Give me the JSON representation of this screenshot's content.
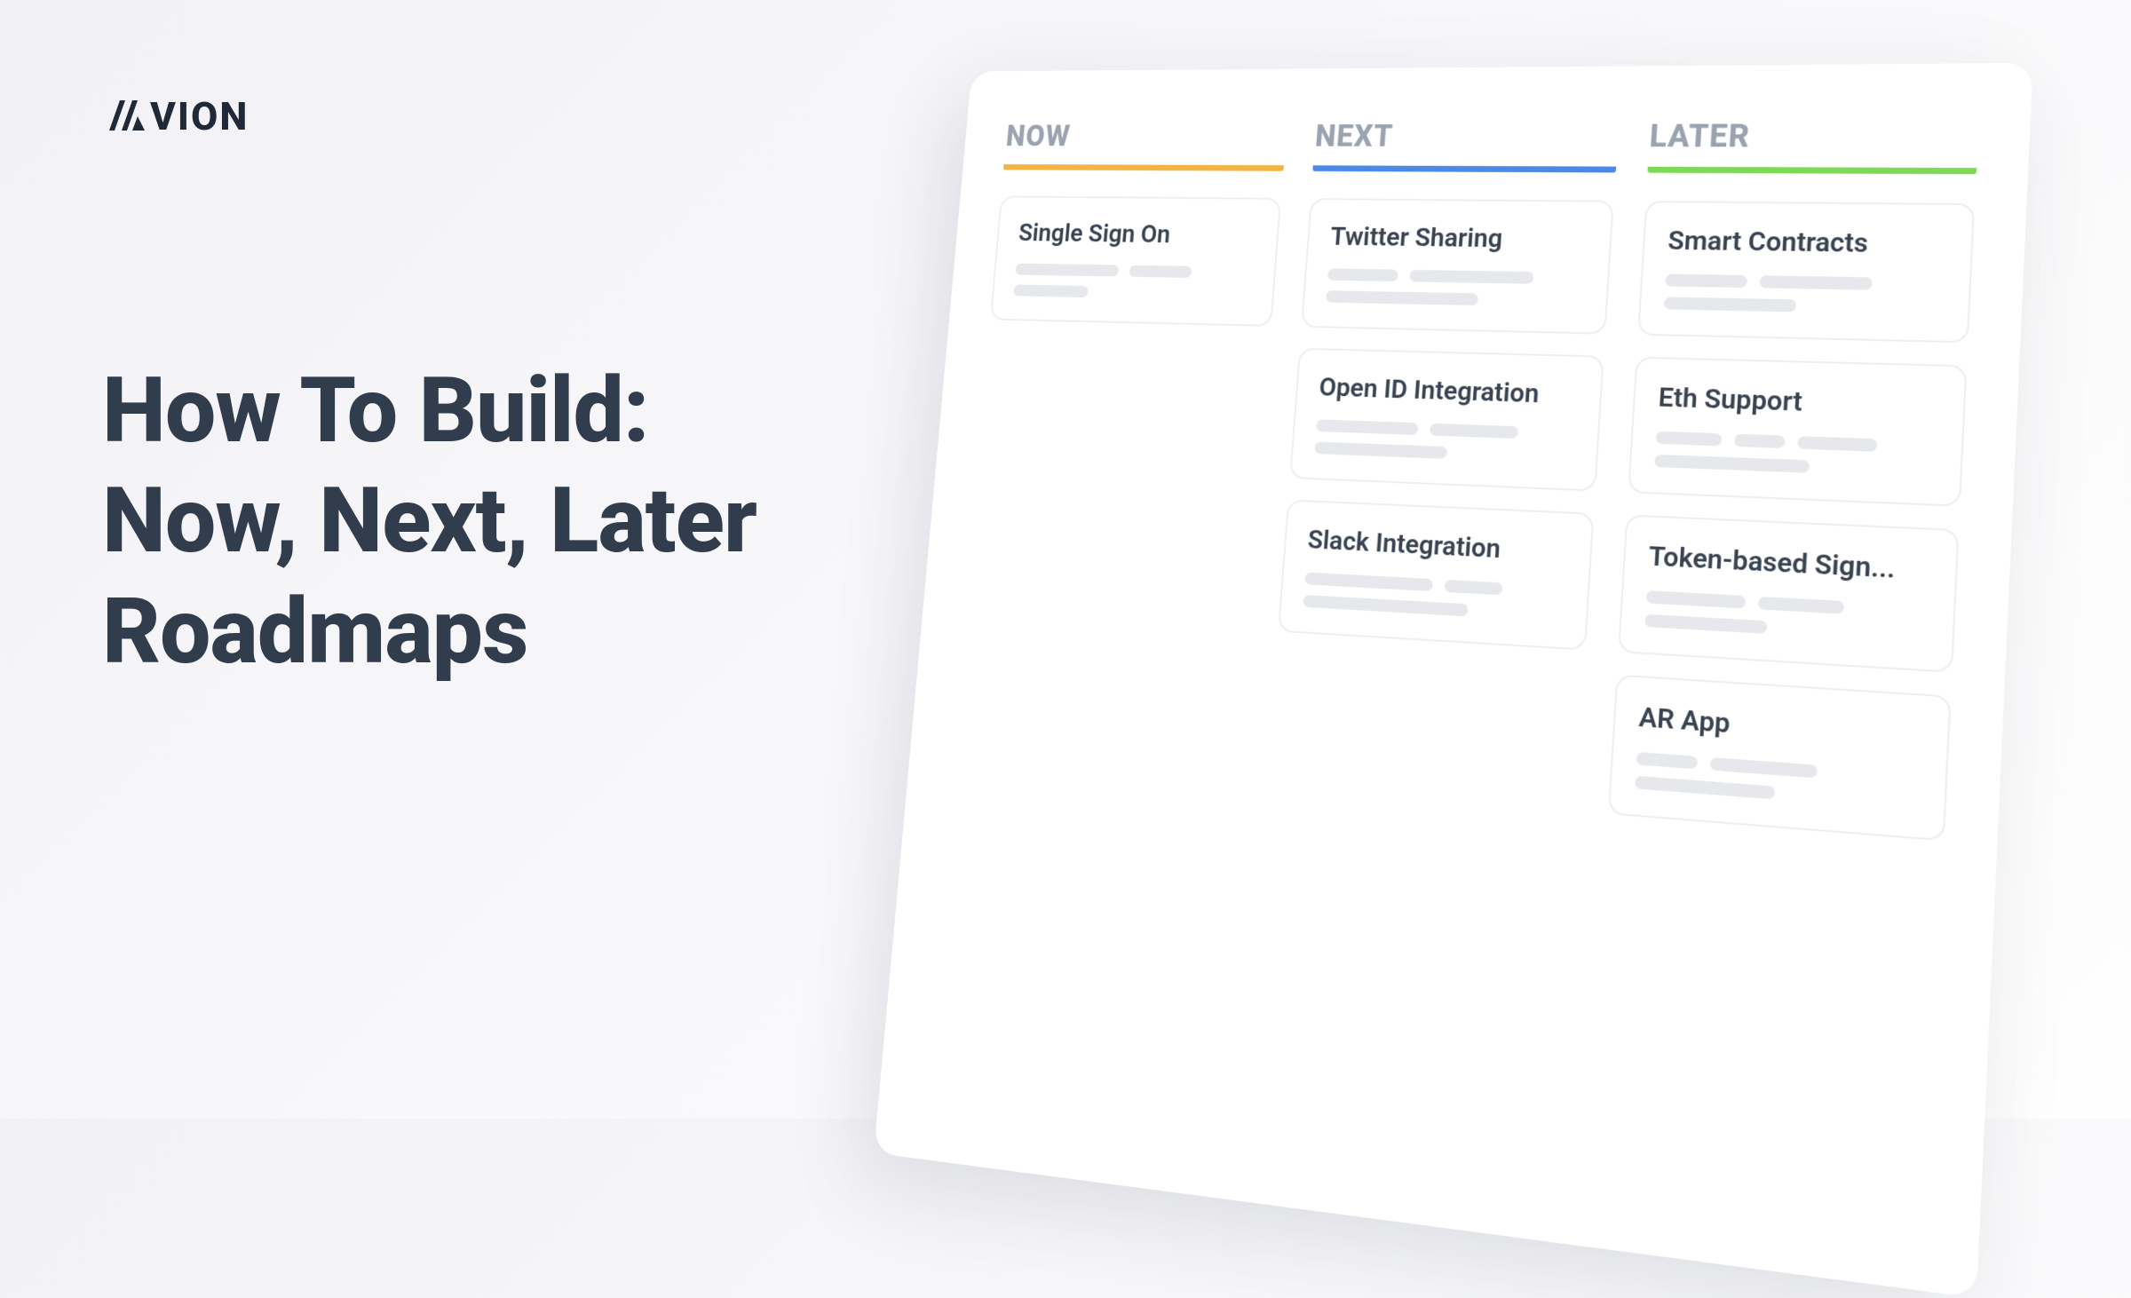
{
  "brand": {
    "name": "VION"
  },
  "headline": {
    "line1": "How To Build:",
    "line2": "Now, Next, Later",
    "line3": "Roadmaps"
  },
  "columns": {
    "now": {
      "label": "NOW",
      "accent": "#f2b544",
      "cards": [
        {
          "title": "Single Sign On"
        }
      ]
    },
    "next": {
      "label": "NEXT",
      "accent": "#4b89e6",
      "cards": [
        {
          "title": "Twitter Sharing"
        },
        {
          "title": "Open ID Integration"
        },
        {
          "title": "Slack Integration"
        }
      ]
    },
    "later": {
      "label": "LATER",
      "accent": "#7ed957",
      "cards": [
        {
          "title": "Smart Contracts"
        },
        {
          "title": "Eth Support"
        },
        {
          "title": "Token-based Sign..."
        },
        {
          "title": "AR App"
        }
      ]
    }
  }
}
